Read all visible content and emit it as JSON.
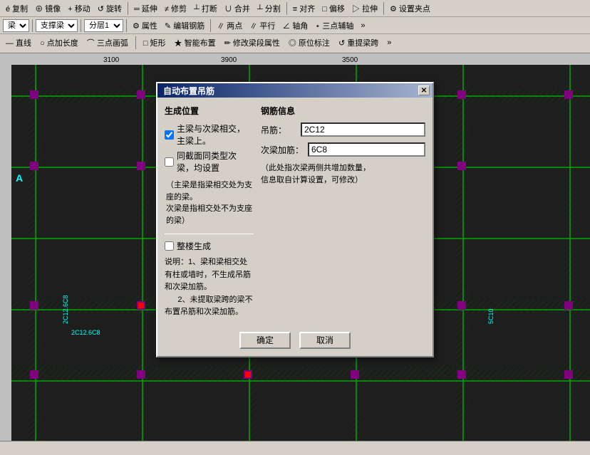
{
  "toolbar": {
    "row1_items": [
      "复制",
      "镜像",
      "移动",
      "旋转",
      "延伸",
      "修剪",
      "打断",
      "合并",
      "分割",
      "对齐",
      "偏移",
      "拉伸",
      "设置夹点"
    ],
    "row2_items": [
      "梁",
      "支撑梁",
      "分层1",
      "属性",
      "编辑钢筋",
      "两点",
      "平行",
      "轴角",
      "三点辅轴"
    ],
    "row3_items": [
      "直线",
      "点加长度",
      "三点画弧",
      "矩形",
      "智能布置",
      "修改梁段属性",
      "原位标注",
      "重提梁跨"
    ]
  },
  "dialog": {
    "title": "自动布置吊筋",
    "left_section": {
      "title": "生成位置",
      "checkbox1": {
        "label": "主梁与次梁相交，主梁上。",
        "checked": true
      },
      "checkbox2": {
        "label": "同截面同类型次梁，均设置",
        "checked": false
      },
      "note1": "（主梁是指梁相交处为支座的梁。\n次梁是指相交处不为支座的梁）",
      "checkbox3": {
        "label": "整楼生成",
        "checked": false
      },
      "note_bottom": "说明：1、梁和梁相交处有柱或墙时，不生成吊筋和次梁加筋。\n    2、未提取梁跨的梁不布置吊筋和次梁加筋。"
    },
    "right_section": {
      "title": "钢筋信息",
      "field_diaojin": {
        "label": "吊筋：",
        "value": "2C12"
      },
      "field_ciliangjiajin": {
        "label": "次梁加筋：",
        "value": "6C8"
      },
      "note_right": "（此处指次梁两侧共增加数量，\n信息取自计算设置，可修改）"
    },
    "buttons": {
      "confirm": "确定",
      "cancel": "取消"
    }
  },
  "statusbar": {
    "text": ""
  },
  "cad": {
    "grid_color": "#00ff00",
    "bg_color": "#1e1e1e",
    "accent_colors": [
      "#ff0000",
      "#00ff00",
      "#800080"
    ],
    "labels": [
      "2C12.6C8",
      "2C12.6C8",
      "2C12.6C8",
      "5C10"
    ],
    "ruler_numbers": [
      "3100",
      "3900",
      "3500"
    ]
  }
}
